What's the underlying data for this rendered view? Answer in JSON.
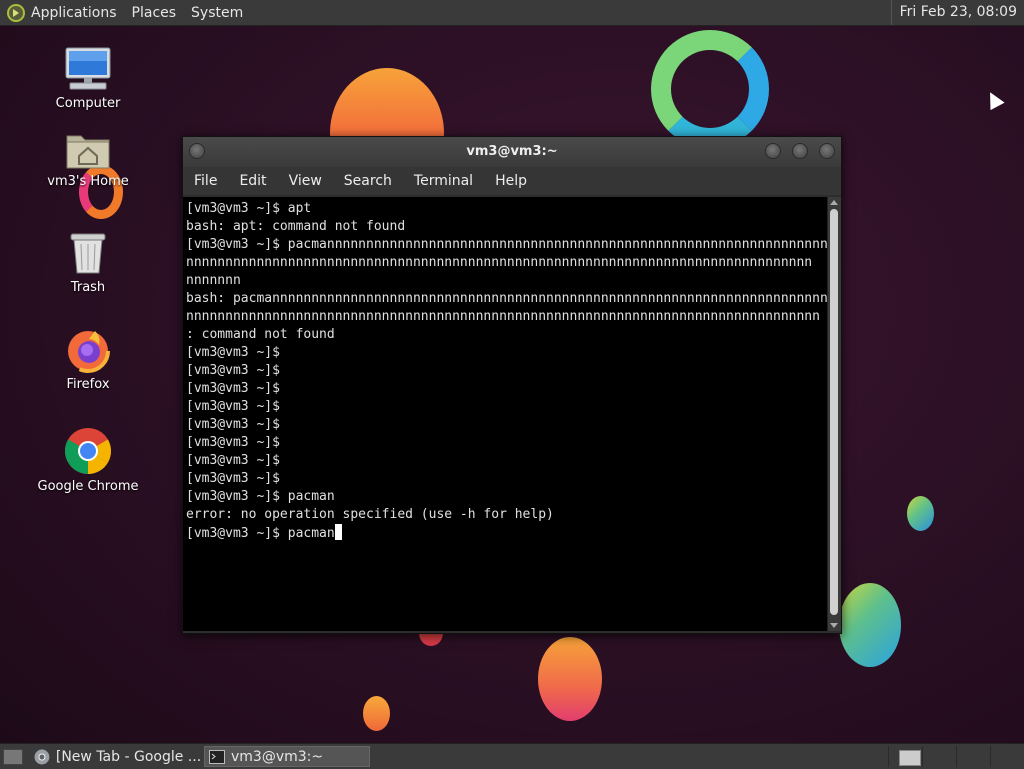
{
  "top_panel": {
    "menus": [
      "Applications",
      "Places",
      "System"
    ],
    "clock": "Fri Feb 23, 08:09"
  },
  "desktop_icons": [
    {
      "label": "Computer",
      "icon": "computer-icon"
    },
    {
      "label": "vm3's Home",
      "icon": "home-folder-icon"
    },
    {
      "label": "Trash",
      "icon": "trash-icon"
    },
    {
      "label": "Firefox",
      "icon": "firefox-icon"
    },
    {
      "label": "Google Chrome",
      "icon": "chrome-icon"
    }
  ],
  "terminal": {
    "title": "vm3@vm3:~",
    "menu": [
      "File",
      "Edit",
      "View",
      "Search",
      "Terminal",
      "Help"
    ],
    "lines": [
      "[vm3@vm3 ~]$ apt",
      "bash: apt: command not found",
      "[vm3@vm3 ~]$ pacmannnnnnnnnnnnnnnnnnnnnnnnnnnnnnnnnnnnnnnnnnnnnnnnnnnnnnnnnnnnnnnnnnnn",
      "nnnnnnnnnnnnnnnnnnnnnnnnnnnnnnnnnnnnnnnnnnnnnnnnnnnnnnnnnnnnnnnnnnnnnnnnnnnnnnnn",
      "nnnnnnn",
      "bash: pacmannnnnnnnnnnnnnnnnnnnnnnnnnnnnnnnnnnnnnnnnnnnnnnnnnnnnnnnnnnnnnnnnnnnnnn",
      "nnnnnnnnnnnnnnnnnnnnnnnnnnnnnnnnnnnnnnnnnnnnnnnnnnnnnnnnnnnnnnnnnnnnnnnnnnnnnnnnn",
      ": command not found",
      "[vm3@vm3 ~]$",
      "[vm3@vm3 ~]$",
      "[vm3@vm3 ~]$",
      "[vm3@vm3 ~]$",
      "[vm3@vm3 ~]$",
      "[vm3@vm3 ~]$",
      "[vm3@vm3 ~]$",
      "[vm3@vm3 ~]$",
      "[vm3@vm3 ~]$ pacman",
      "error: no operation specified (use -h for help)"
    ],
    "prompt_line": "[vm3@vm3 ~]$ pacman"
  },
  "taskbar": {
    "tasks": [
      {
        "label": "[New Tab - Google ...",
        "icon": "chrome-icon"
      },
      {
        "label": "vm3@vm3:~",
        "icon": "terminal-icon"
      }
    ]
  },
  "colors": {
    "panel_bg": "#3a3a3a",
    "terminal_bg": "#000000",
    "terminal_fg": "#e0e0e0",
    "desktop_bg": "#2a0f23"
  }
}
